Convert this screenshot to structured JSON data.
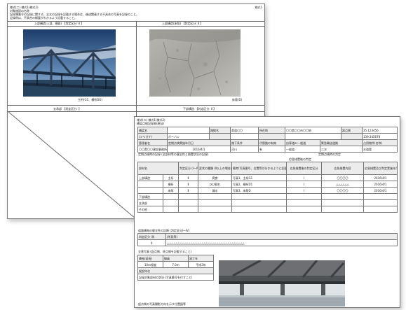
{
  "back_sheet": {
    "header_line1": "様式(二) 様式1(様式2)",
    "header_line2": "対象施設の名称",
    "header_right": "様式1",
    "note_line1": "記録簿番号の記録に関する、全文の記録を記載する場合は、後述関連する不具合の写真を記録のこと。",
    "note_line2": "記録例は、不具合の概要がわかるよう記載すること。",
    "photo_left_caption_top": "上部構造(上部、横面) 【判定区分: Ⅱ 】",
    "photo_right_caption_top": "上部構造(床版) 【判定区分: Ⅱ 】",
    "photo_left_note": "主桁(G1、横桁DO)",
    "photo_right_note": "床版(D)",
    "lower_left_label": "支承部 【判定区分: 】",
    "lower_right_label": "下部構造 【判定区分: Ⅱ 】"
  },
  "front_sheet": {
    "header_line1": "様式(二) 様式1(様式2)",
    "header_line2": "橋梁点検記録表(総括)",
    "rows": {
      "bridge_name_label": "橋梁名",
      "route_label": "路線名",
      "route_value": "県道〇〇",
      "location_label": "所在地",
      "location_value": "〇〇県〇〇市〇〇地",
      "lat_label": "起点側",
      "lat_value": "35.123456",
      "lon_value": "139.345678",
      "furigana_label": "(フリガナ)",
      "furigana_value": "ボーバシ",
      "admin_label": "管理者名",
      "admin_value": "〇〇県〇〇建設事務所〇〇出張所",
      "inspect_date_label": "定期点検実施年月日",
      "inspect_date_value": "2016/4/1",
      "road_class_label": "路下条件",
      "road_class_value": "河川",
      "code_label": "代替路の有無",
      "code_value": "有",
      "emergency_label": "自専道or一般道",
      "emergency_value": "一般道",
      "bus_label": "緊急輸送道路",
      "bus_value": "二次",
      "occupied_label": "占用物件(名称)",
      "occupied_value": "水道管"
    },
    "summary_label": "定期点検時の記録 (全部材等の健全性と措置状況の記録)",
    "judgement_label": "定期点検時の判定",
    "repair_label": "応急措置後の判定",
    "columns": [
      "部材名",
      "判定区分 (Ⅰ～Ⅳ)",
      "変状の種類 (Ⅱ以上の場合に記載)",
      "備考(写真番号、位置等が分かるように記載)",
      "応急措置後の判定区分",
      "応急措置内容",
      "応急措置及び判定実施年月日"
    ],
    "members": [
      {
        "name": "上部構造",
        "sub": "主桁",
        "grade": "Ⅱ",
        "type": "腐食",
        "note": "写真1、主桁G1",
        "after": "Ⅰ",
        "action": "〇〇〇〇",
        "date": "2016/4/1"
      },
      {
        "name": "",
        "sub": "横桁",
        "grade": "Ⅱ",
        "type": "ひび割れ",
        "note": "写真2、横桁D1",
        "after": "Ⅰ",
        "action": "△△△△△△",
        "date": "2016/4/1"
      },
      {
        "name": "",
        "sub": "床版",
        "grade": "Ⅱ",
        "type": "漏水",
        "note": "写真3、床版D",
        "after": "Ⅰ",
        "action": "〇〇〇〇",
        "date": "2016/4/1"
      },
      {
        "name": "下部構造",
        "sub": "",
        "grade": "",
        "type": "",
        "note": "",
        "after": "",
        "action": "",
        "date": ""
      },
      {
        "name": "支承部",
        "sub": "",
        "grade": "",
        "type": "",
        "note": "",
        "after": "",
        "action": "",
        "date": ""
      },
      {
        "name": "その他",
        "sub": "",
        "grade": "",
        "type": "",
        "note": "",
        "after": "",
        "action": "",
        "date": ""
      }
    ],
    "health_label": "道路橋毎の健全性の診断 (判定区分Ⅰ～Ⅳ)",
    "health_sub": "(判定区分)",
    "health_grade_label": "判定区分 (Ⅱ)",
    "health_remark_label": "(所見等)",
    "health_grade": "Ⅱ",
    "health_remark": "△△△△△△△△△△△△△△△△△△△△△△△△△△△△△△△△△△△△",
    "spec_label": "全景写真 (起点側、終点側を記載すること)",
    "spec_length_label": "橋長(延長)",
    "spec_width_label": "幅員",
    "spec_year_label": "竣工年",
    "spec_length": "10m程度",
    "spec_width": "7.0m",
    "spec_year": "平成3年",
    "spec_type_label": "架設年次",
    "photo_caption": "記録対象部材の状況 (写真番号を付すこと)",
    "bottom_note": "起点側の写真撮影方向を示す位置図等"
  }
}
